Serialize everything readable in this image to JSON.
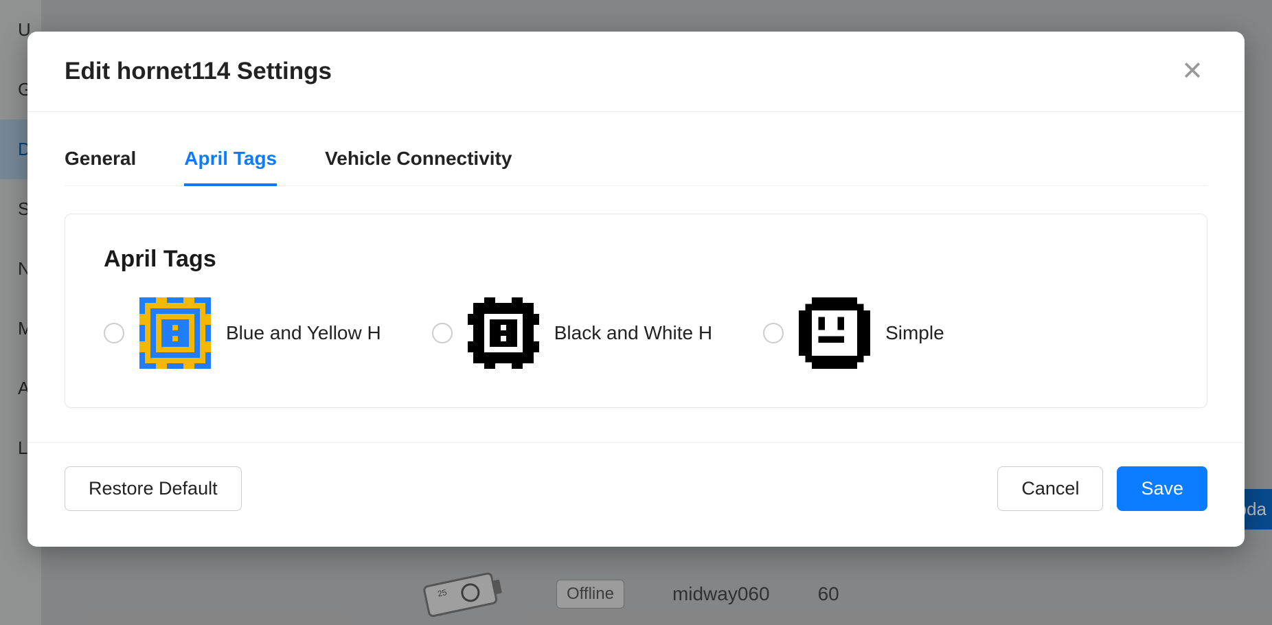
{
  "background": {
    "sidebar_letters": [
      "U",
      "G",
      "D",
      "S",
      "N",
      "M",
      "A",
      "L"
    ],
    "active_sidebar_index": 2,
    "update_button_fragment": "pda",
    "row": {
      "status": "Offline",
      "name": "midway060",
      "id": "60"
    }
  },
  "modal": {
    "title": "Edit hornet114 Settings",
    "tabs": [
      {
        "label": "General",
        "active": false
      },
      {
        "label": "April Tags",
        "active": true
      },
      {
        "label": "Vehicle Connectivity",
        "active": false
      }
    ],
    "card": {
      "title": "April Tags",
      "options": [
        {
          "label": "Blue and Yellow H",
          "icon": "blue-yellow-h"
        },
        {
          "label": "Black and White H",
          "icon": "black-white-h"
        },
        {
          "label": "Simple",
          "icon": "simple"
        }
      ]
    },
    "footer": {
      "restore_label": "Restore Default",
      "cancel_label": "Cancel",
      "save_label": "Save"
    }
  }
}
